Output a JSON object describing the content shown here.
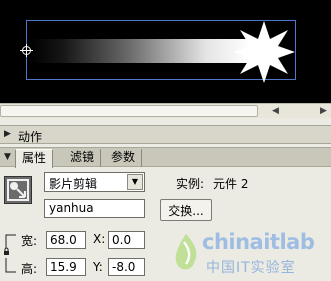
{
  "stage": {
    "background": "#000000",
    "selection_color": "#4f78cc",
    "shape_fill": "#ffffff"
  },
  "panels": {
    "actions": {
      "collapsed": true,
      "label": "动作"
    },
    "properties_panel": {
      "tabs": [
        {
          "label": "属性",
          "active": true
        },
        {
          "label": "滤镜",
          "active": false
        },
        {
          "label": "参数",
          "active": false
        }
      ]
    }
  },
  "properties": {
    "symbol_icon": "movieclip-symbol-icon",
    "symbol_type": "影片剪辑",
    "instance_name": "yanhua",
    "instance_of_label": "实例:",
    "instance_of_value": "元件 2",
    "swap_button": "交换...",
    "width_label": "宽:",
    "width_value": "68.0",
    "height_label": "高:",
    "height_value": "15.9",
    "x_label": "X:",
    "x_value": "0.0",
    "y_label": "Y:",
    "y_value": "-8.0"
  },
  "watermark": {
    "brand": "chinaitlab",
    "subtitle": "中国IT实验室"
  }
}
